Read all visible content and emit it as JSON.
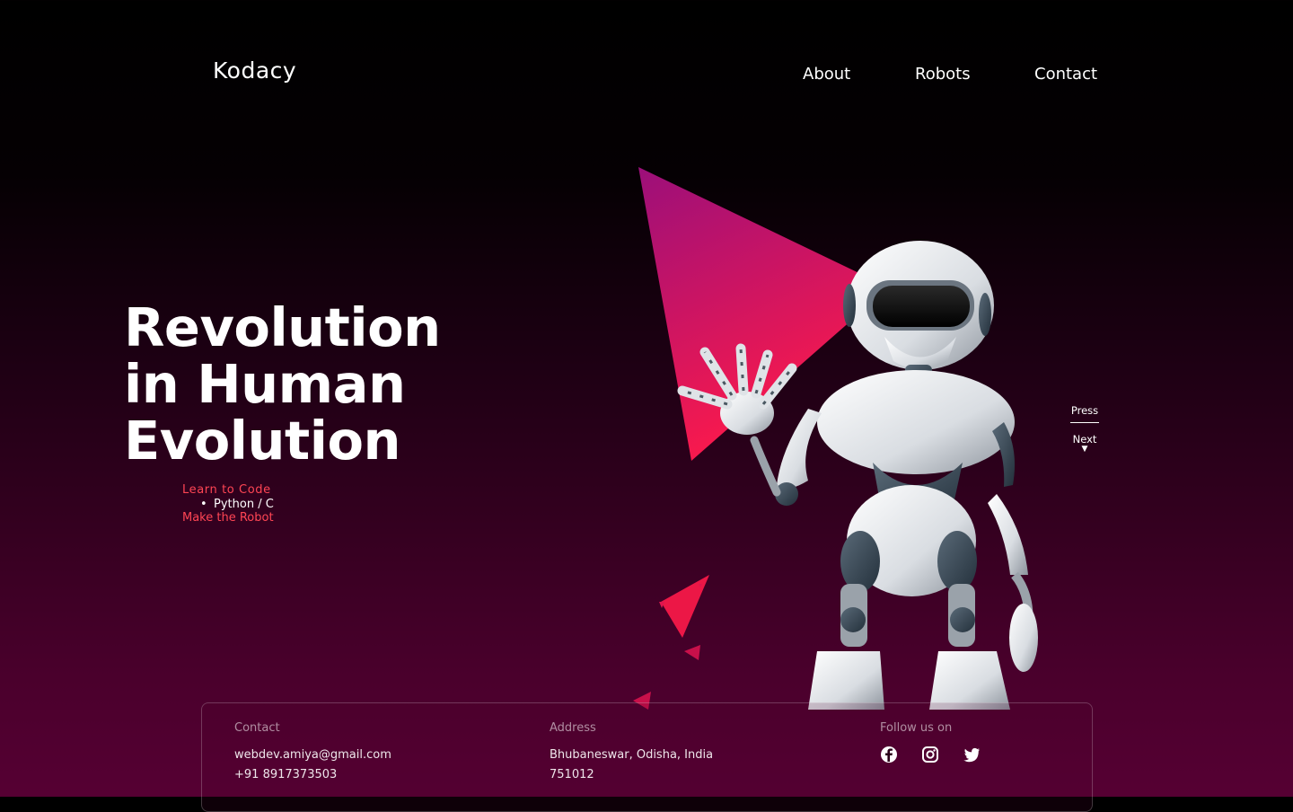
{
  "header": {
    "logo": "Kodacy",
    "nav": [
      "About",
      "Robots",
      "Contact"
    ]
  },
  "hero": {
    "headline_lines": [
      "Revolution",
      "in Human",
      "Evolution"
    ],
    "sub_learn": "Learn to Code",
    "sub_bullet": "Python / C",
    "sub_make": "Make the Robot",
    "press": "Press",
    "next": "Next",
    "next_arrow": "▼"
  },
  "footer": {
    "contact_head": "Contact",
    "email": "webdev.amiya@gmail.com",
    "phone": "+91 8917373503",
    "address_head": "Address",
    "address_line1": "Bhubaneswar, Odisha, India",
    "address_line2": "751012",
    "follow_head": "Follow us on",
    "socials": [
      "facebook-icon",
      "instagram-icon",
      "twitter-icon"
    ]
  },
  "colors": {
    "accent": "#ff4554",
    "triangle_top": "#9b0f7a",
    "triangle_bottom": "#ff1a4a"
  }
}
